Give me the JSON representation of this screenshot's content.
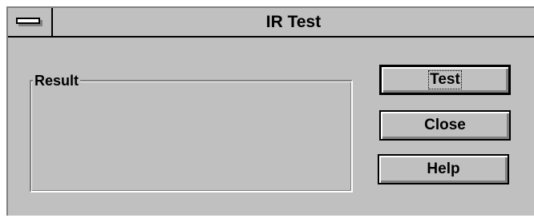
{
  "window": {
    "title": "IR Test"
  },
  "result_group": {
    "label": "Result"
  },
  "buttons": {
    "test": "Test",
    "close": "Close",
    "help": "Help"
  }
}
